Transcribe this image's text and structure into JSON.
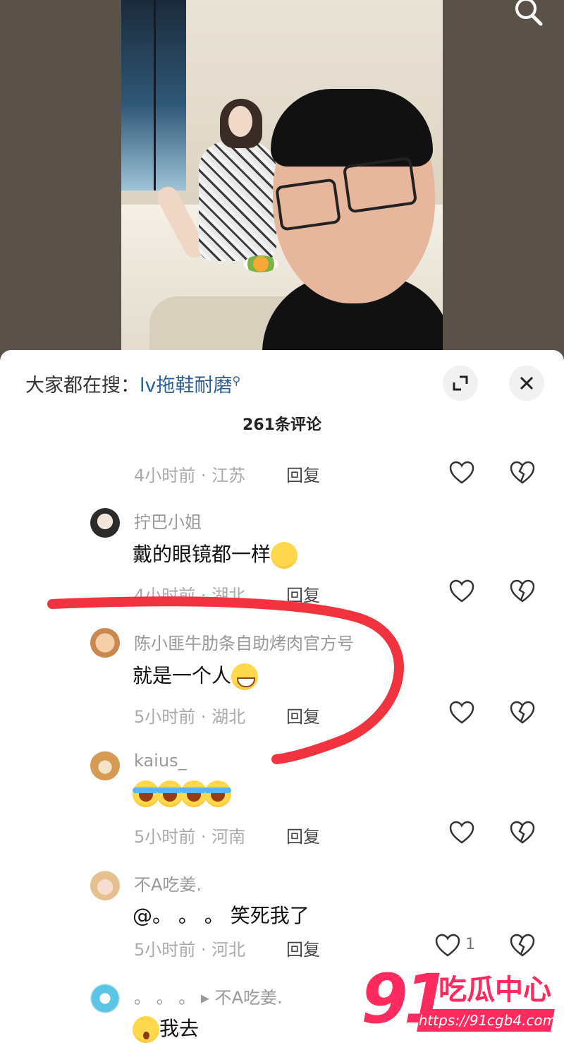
{
  "header": {
    "search_icon": "search-icon"
  },
  "sheet": {
    "hot_search_prefix": "大家都在搜：",
    "hot_search_keyword": "lv拖鞋耐磨",
    "expand_icon": "expand-icon",
    "close_icon": "close-icon",
    "comment_count": "261条评论"
  },
  "comments": [
    {
      "username": "",
      "text": "",
      "time": "4小时前",
      "location": "江苏",
      "reply": "回复",
      "likes": ""
    },
    {
      "username": "拧巴小姐",
      "text": "戴的眼镜都一样",
      "emoji": "crying-face",
      "time": "4小时前",
      "location": "湖北",
      "reply": "回复",
      "likes": ""
    },
    {
      "username": "陈小匪牛肋条自助烤肉官方号",
      "text": "就是一个人",
      "emoji": "grinning-sweat-face",
      "time": "5小时前",
      "location": "湖北",
      "reply": "回复",
      "likes": ""
    },
    {
      "username": "kaius_",
      "text": "",
      "emoji": "loudly-crying-face x4",
      "time": "5小时前",
      "location": "河南",
      "reply": "回复",
      "likes": ""
    },
    {
      "username": "不A吃姜.",
      "text": "@。 。 。 笑死我了",
      "time": "5小时前",
      "location": "河北",
      "reply": "回复",
      "likes": "1"
    },
    {
      "username": "。 。 。",
      "reply_to": "不A吃姜.",
      "text": "我去",
      "emoji": "shocked-face"
    }
  ],
  "watermark": {
    "number": "91",
    "name": "吃瓜中心",
    "url": "https://91cgb4.com"
  },
  "colors": {
    "accent_link": "#2d5f93",
    "annotation_red": "#f0333f",
    "watermark": "#ff2b5e"
  }
}
